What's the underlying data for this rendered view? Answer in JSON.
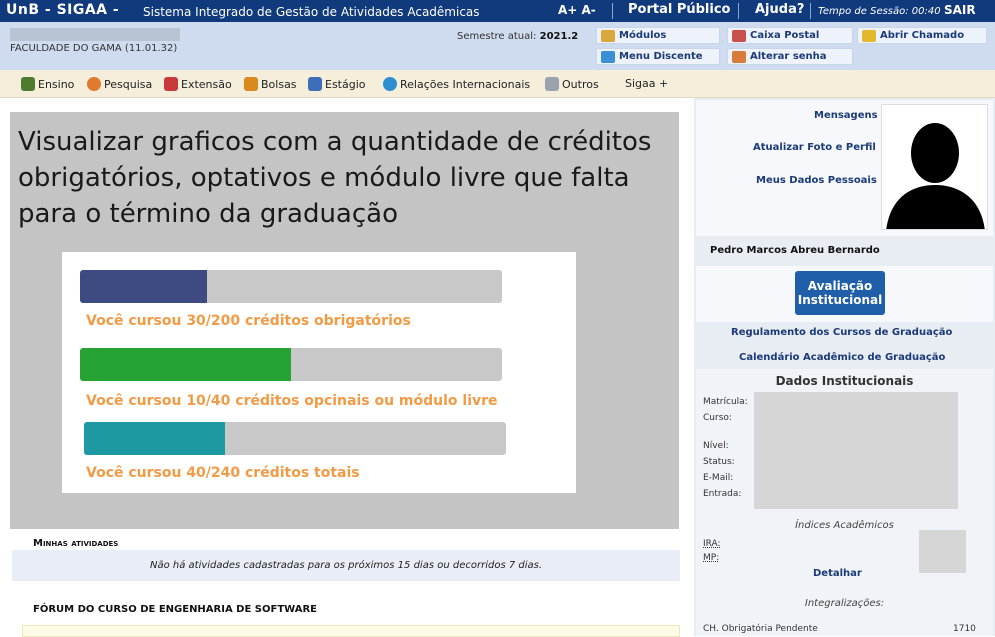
{
  "topbar": {
    "brand": "UnB - SIGAA -",
    "system_name": "Sistema Integrado de Gestão de Atividades Acadêmicas",
    "font_controls": "A+ A-",
    "portal_publico": "Portal Público",
    "ajuda": "Ajuda?",
    "session_time": "Tempo de Sessão: 00:40",
    "sair": "SAIR"
  },
  "infobar": {
    "faculdade": "FACULDADE DO GAMA (11.01.32)",
    "semestre_label": "Semestre atual:",
    "semestre_value": "2021.2",
    "buttons": [
      "Módulos",
      "Caixa Postal",
      "Abrir Chamado",
      "Menu Discente",
      "Alterar senha"
    ]
  },
  "menu": {
    "items": [
      "Ensino",
      "Pesquisa",
      "Extensão",
      "Bolsas",
      "Estágio",
      "Relações Internacionais",
      "Outros",
      "Sigaa +"
    ]
  },
  "overlay": {
    "title": "Visualizar graficos com a quantidade de créditos obrigatórios, optativos e módulo livre que falta para o término da graduação",
    "progress": [
      {
        "label": "Você cursou 30/200 créditos obrigatórios",
        "done": 30,
        "total": 200,
        "color": "#3e4a82"
      },
      {
        "label": "Você cursou 10/40 créditos opcinais ou módulo livre",
        "done": 10,
        "total": 40,
        "color": "#27a334"
      },
      {
        "label": "Você cursou 40/240 créditos totais",
        "done": 40,
        "total": 240,
        "color": "#1d9aa1"
      }
    ]
  },
  "atividades": {
    "title": "Minhas atividades",
    "empty_text": "Não há atividades cadastradas para os próximos 15 dias ou decorridos 7 dias."
  },
  "forum": {
    "title": "FÓRUM DO CURSO DE ENGENHARIA DE SOFTWARE"
  },
  "sidebar": {
    "links": [
      "Mensagens",
      "Atualizar Foto e Perfil",
      "Meus Dados Pessoais"
    ],
    "user_name": "Pedro Marcos Abreu Bernardo",
    "avaliacao": "Avaliação Institucional",
    "regulamento": "Regulamento dos Cursos de Graduação",
    "calendario": "Calendário Acadêmico de Graduação",
    "dados_title": "Dados Institucionais",
    "dados_labels": [
      "Matrícula:",
      "Curso:",
      "Nível:",
      "Status:",
      "E-Mail:",
      "Entrada:"
    ],
    "indices_title": "Índices Acadêmicos",
    "ira_label": "IRA:",
    "mp_label": "MP:",
    "detalhar": "Detalhar",
    "integralizacoes": "Integralizações:",
    "ch_label": "CH. Obrigatória Pendente",
    "ch_value": "1710"
  },
  "colors": {
    "topbar": "#103a7b",
    "infobar": "#cfdbef",
    "menubar": "#f4eedb",
    "progress_text": "#f39a45"
  }
}
